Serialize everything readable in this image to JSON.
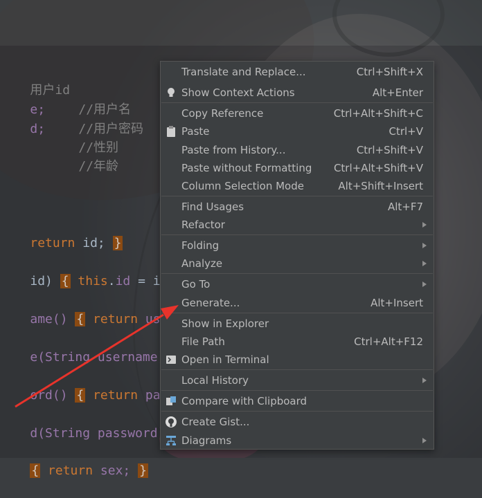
{
  "code": {
    "lines": [
      {
        "id": "l1",
        "text": "用户id"
      },
      {
        "id": "l2a",
        "text": "e;"
      },
      {
        "id": "l2b",
        "text": "//用户名"
      },
      {
        "id": "l3a",
        "text": "d;"
      },
      {
        "id": "l3b",
        "text": "//用户密码"
      },
      {
        "id": "l4",
        "text": "//性别"
      },
      {
        "id": "l5",
        "text": "//年龄"
      }
    ],
    "methods": {
      "m1_kw": "return",
      "m1_rest": " id; ",
      "m1_brace": "}",
      "m2_a": "id) ",
      "m2_brace": "{",
      "m2_this": " this",
      "m2_dot": ".",
      "m2_fld": "id",
      "m2_rest": " = id;",
      "m3_a": "ame() ",
      "m3_brace": "{",
      "m3_kw": " return",
      "m3_rest": " usern",
      "m4_a": "e(String username) ",
      "m4_brace": "{",
      "m5_a": "ord() ",
      "m5_brace": "{",
      "m5_kw": " return",
      "m5_rest": " passw",
      "m6_a": "d(String password) ",
      "m6_brace": "{",
      "m7_brace": "{",
      "m7_kw": " return",
      "m7_rest": " sex; ",
      "m7_brace2": "}"
    }
  },
  "menu": {
    "items": [
      {
        "label": "Translate and Replace...",
        "shortcut": "Ctrl+Shift+X"
      },
      {
        "label": "Show Context Actions",
        "shortcut": "Alt+Enter",
        "icon": "lightbulb-icon"
      },
      {
        "label": "Copy Reference",
        "shortcut": "Ctrl+Alt+Shift+C"
      },
      {
        "label": "Paste",
        "shortcut": "Ctrl+V",
        "icon": "clipboard-icon"
      },
      {
        "label": "Paste from History...",
        "shortcut": "Ctrl+Shift+V"
      },
      {
        "label": "Paste without Formatting",
        "shortcut": "Ctrl+Alt+Shift+V"
      },
      {
        "label": "Column Selection Mode",
        "shortcut": "Alt+Shift+Insert"
      },
      {
        "label": "Find Usages",
        "shortcut": "Alt+F7"
      },
      {
        "label": "Refactor",
        "submenu": true
      },
      {
        "label": "Folding",
        "submenu": true
      },
      {
        "label": "Analyze",
        "submenu": true
      },
      {
        "label": "Go To",
        "submenu": true
      },
      {
        "label": "Generate...",
        "shortcut": "Alt+Insert"
      },
      {
        "label": "Show in Explorer"
      },
      {
        "label": "File Path",
        "shortcut": "Ctrl+Alt+F12"
      },
      {
        "label": "Open in Terminal",
        "icon": "terminal-icon"
      },
      {
        "label": "Local History",
        "submenu": true
      },
      {
        "label": "Compare with Clipboard",
        "icon": "compare-icon"
      },
      {
        "label": "Create Gist...",
        "icon": "github-icon"
      },
      {
        "label": "Diagrams",
        "submenu": true,
        "icon": "diagram-icon"
      }
    ]
  },
  "colors": {
    "menu_bg": "#3c3f41",
    "annotation_arrow": "#e8332b",
    "brace_highlight": "#8b4a12"
  }
}
